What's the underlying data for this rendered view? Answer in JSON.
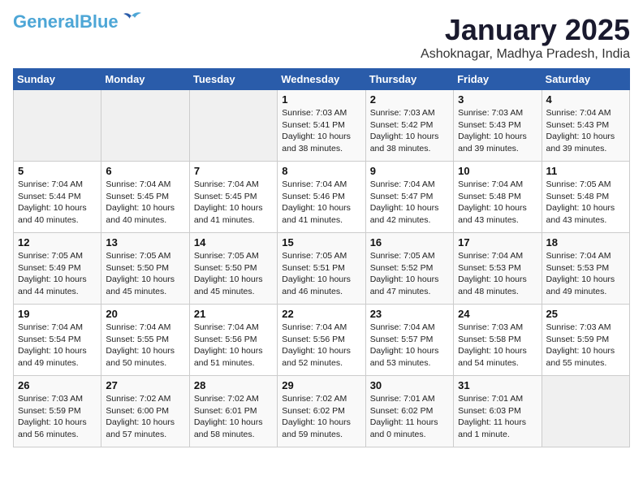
{
  "logo": {
    "general": "General",
    "blue": "Blue"
  },
  "header": {
    "title": "January 2025",
    "location": "Ashoknagar, Madhya Pradesh, India"
  },
  "weekdays": [
    "Sunday",
    "Monday",
    "Tuesday",
    "Wednesday",
    "Thursday",
    "Friday",
    "Saturday"
  ],
  "weeks": [
    [
      {
        "day": "",
        "info": ""
      },
      {
        "day": "",
        "info": ""
      },
      {
        "day": "",
        "info": ""
      },
      {
        "day": "1",
        "info": "Sunrise: 7:03 AM\nSunset: 5:41 PM\nDaylight: 10 hours\nand 38 minutes."
      },
      {
        "day": "2",
        "info": "Sunrise: 7:03 AM\nSunset: 5:42 PM\nDaylight: 10 hours\nand 38 minutes."
      },
      {
        "day": "3",
        "info": "Sunrise: 7:03 AM\nSunset: 5:43 PM\nDaylight: 10 hours\nand 39 minutes."
      },
      {
        "day": "4",
        "info": "Sunrise: 7:04 AM\nSunset: 5:43 PM\nDaylight: 10 hours\nand 39 minutes."
      }
    ],
    [
      {
        "day": "5",
        "info": "Sunrise: 7:04 AM\nSunset: 5:44 PM\nDaylight: 10 hours\nand 40 minutes."
      },
      {
        "day": "6",
        "info": "Sunrise: 7:04 AM\nSunset: 5:45 PM\nDaylight: 10 hours\nand 40 minutes."
      },
      {
        "day": "7",
        "info": "Sunrise: 7:04 AM\nSunset: 5:45 PM\nDaylight: 10 hours\nand 41 minutes."
      },
      {
        "day": "8",
        "info": "Sunrise: 7:04 AM\nSunset: 5:46 PM\nDaylight: 10 hours\nand 41 minutes."
      },
      {
        "day": "9",
        "info": "Sunrise: 7:04 AM\nSunset: 5:47 PM\nDaylight: 10 hours\nand 42 minutes."
      },
      {
        "day": "10",
        "info": "Sunrise: 7:04 AM\nSunset: 5:48 PM\nDaylight: 10 hours\nand 43 minutes."
      },
      {
        "day": "11",
        "info": "Sunrise: 7:05 AM\nSunset: 5:48 PM\nDaylight: 10 hours\nand 43 minutes."
      }
    ],
    [
      {
        "day": "12",
        "info": "Sunrise: 7:05 AM\nSunset: 5:49 PM\nDaylight: 10 hours\nand 44 minutes."
      },
      {
        "day": "13",
        "info": "Sunrise: 7:05 AM\nSunset: 5:50 PM\nDaylight: 10 hours\nand 45 minutes."
      },
      {
        "day": "14",
        "info": "Sunrise: 7:05 AM\nSunset: 5:50 PM\nDaylight: 10 hours\nand 45 minutes."
      },
      {
        "day": "15",
        "info": "Sunrise: 7:05 AM\nSunset: 5:51 PM\nDaylight: 10 hours\nand 46 minutes."
      },
      {
        "day": "16",
        "info": "Sunrise: 7:05 AM\nSunset: 5:52 PM\nDaylight: 10 hours\nand 47 minutes."
      },
      {
        "day": "17",
        "info": "Sunrise: 7:04 AM\nSunset: 5:53 PM\nDaylight: 10 hours\nand 48 minutes."
      },
      {
        "day": "18",
        "info": "Sunrise: 7:04 AM\nSunset: 5:53 PM\nDaylight: 10 hours\nand 49 minutes."
      }
    ],
    [
      {
        "day": "19",
        "info": "Sunrise: 7:04 AM\nSunset: 5:54 PM\nDaylight: 10 hours\nand 49 minutes."
      },
      {
        "day": "20",
        "info": "Sunrise: 7:04 AM\nSunset: 5:55 PM\nDaylight: 10 hours\nand 50 minutes."
      },
      {
        "day": "21",
        "info": "Sunrise: 7:04 AM\nSunset: 5:56 PM\nDaylight: 10 hours\nand 51 minutes."
      },
      {
        "day": "22",
        "info": "Sunrise: 7:04 AM\nSunset: 5:56 PM\nDaylight: 10 hours\nand 52 minutes."
      },
      {
        "day": "23",
        "info": "Sunrise: 7:04 AM\nSunset: 5:57 PM\nDaylight: 10 hours\nand 53 minutes."
      },
      {
        "day": "24",
        "info": "Sunrise: 7:03 AM\nSunset: 5:58 PM\nDaylight: 10 hours\nand 54 minutes."
      },
      {
        "day": "25",
        "info": "Sunrise: 7:03 AM\nSunset: 5:59 PM\nDaylight: 10 hours\nand 55 minutes."
      }
    ],
    [
      {
        "day": "26",
        "info": "Sunrise: 7:03 AM\nSunset: 5:59 PM\nDaylight: 10 hours\nand 56 minutes."
      },
      {
        "day": "27",
        "info": "Sunrise: 7:02 AM\nSunset: 6:00 PM\nDaylight: 10 hours\nand 57 minutes."
      },
      {
        "day": "28",
        "info": "Sunrise: 7:02 AM\nSunset: 6:01 PM\nDaylight: 10 hours\nand 58 minutes."
      },
      {
        "day": "29",
        "info": "Sunrise: 7:02 AM\nSunset: 6:02 PM\nDaylight: 10 hours\nand 59 minutes."
      },
      {
        "day": "30",
        "info": "Sunrise: 7:01 AM\nSunset: 6:02 PM\nDaylight: 11 hours\nand 0 minutes."
      },
      {
        "day": "31",
        "info": "Sunrise: 7:01 AM\nSunset: 6:03 PM\nDaylight: 11 hours\nand 1 minute."
      },
      {
        "day": "",
        "info": ""
      }
    ]
  ]
}
